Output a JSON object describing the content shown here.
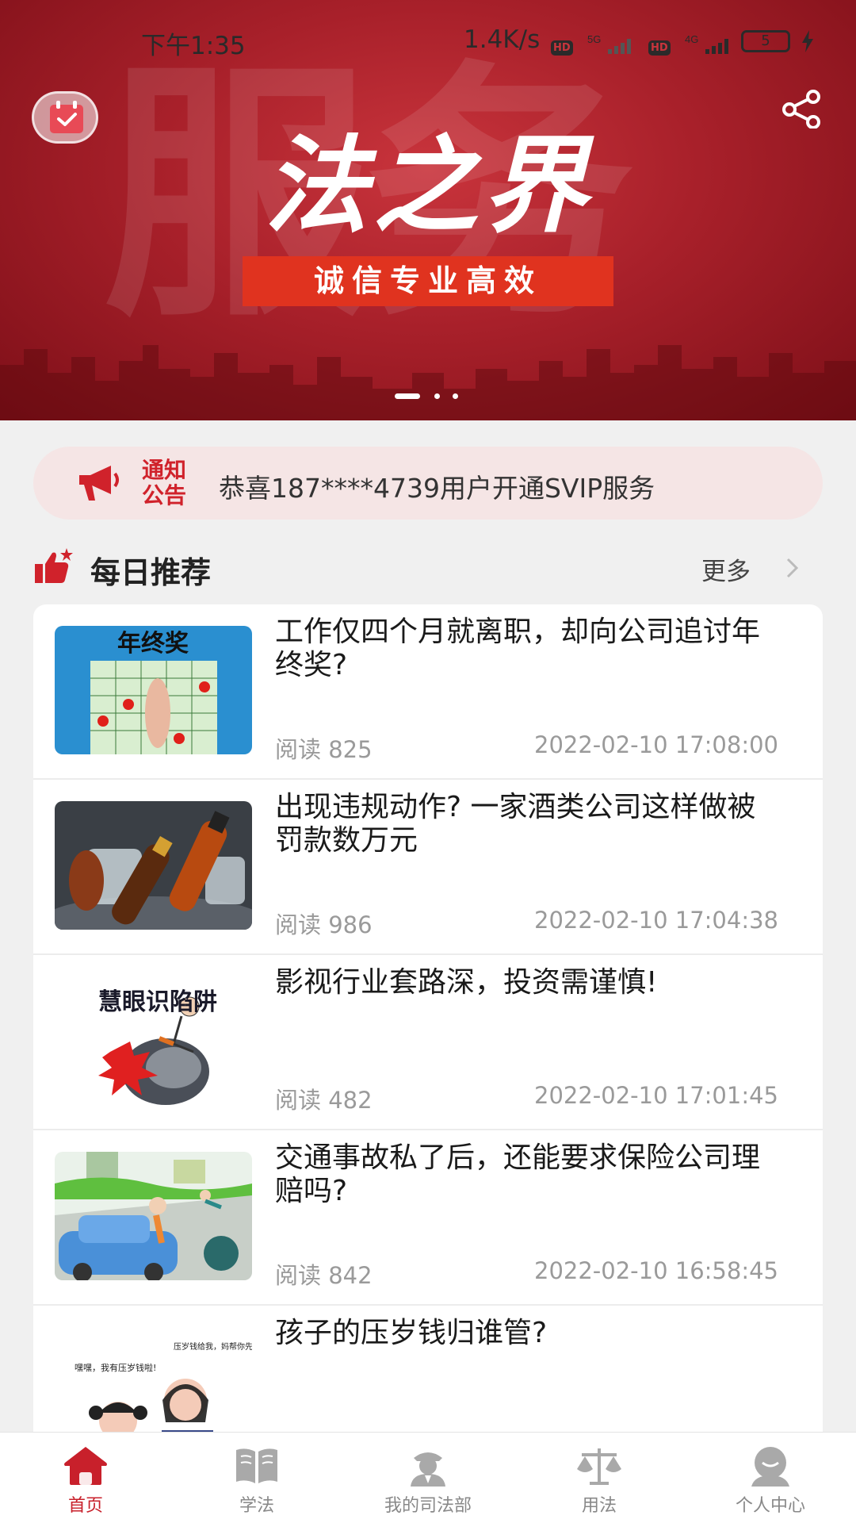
{
  "status_bar": {
    "time": "下午1:35",
    "net_speed": "1.4K/s",
    "hd_label": "HD",
    "sim1_type": "5G",
    "sim2_type": "4G",
    "battery": "5"
  },
  "banner": {
    "watermark": "服务",
    "title": "法之界",
    "slogan": "诚信专业高效",
    "slide_count": 3,
    "active_slide": 1
  },
  "notice": {
    "tag_line1": "通知",
    "tag_line2": "公告",
    "text": "恭喜187****4739用户开通SVIP服务"
  },
  "section": {
    "title": "每日推荐",
    "more": "更多"
  },
  "articles": [
    {
      "title": "工作仅四个月就离职，却向公司追讨年终奖?",
      "reads": "阅读  825",
      "date": "2022-02-10 17:08:00",
      "image_label": "年终奖"
    },
    {
      "title": "出现违规动作? 一家酒类公司这样做被罚款数万元",
      "reads": "阅读  986",
      "date": "2022-02-10 17:04:38"
    },
    {
      "title": "影视行业套路深，投资需谨慎!",
      "reads": "阅读  482",
      "date": "2022-02-10 17:01:45",
      "image_label": "慧眼识陷阱"
    },
    {
      "title": "交通事故私了后，还能要求保险公司理赔吗?",
      "reads": "阅读  842",
      "date": "2022-02-10 16:58:45"
    },
    {
      "title": "孩子的压岁钱归谁管?",
      "reads": "",
      "date": "",
      "image_label_left": "嘿嘿，我有压岁钱啦!",
      "image_label_right": "压岁钱给我，妈帮你先存着。"
    }
  ],
  "nav": [
    {
      "label": "首页",
      "icon": "home-icon",
      "active": true
    },
    {
      "label": "学法",
      "icon": "book-icon",
      "active": false
    },
    {
      "label": "我的司法部",
      "icon": "officer-icon",
      "active": false
    },
    {
      "label": "用法",
      "icon": "scales-icon",
      "active": false
    },
    {
      "label": "个人中心",
      "icon": "user-icon",
      "active": false
    }
  ],
  "colors": {
    "brand_red": "#c8202b",
    "banner_red": "#a8202a",
    "slogan_red": "#e0331f",
    "notice_bg": "#f5e5e5"
  }
}
